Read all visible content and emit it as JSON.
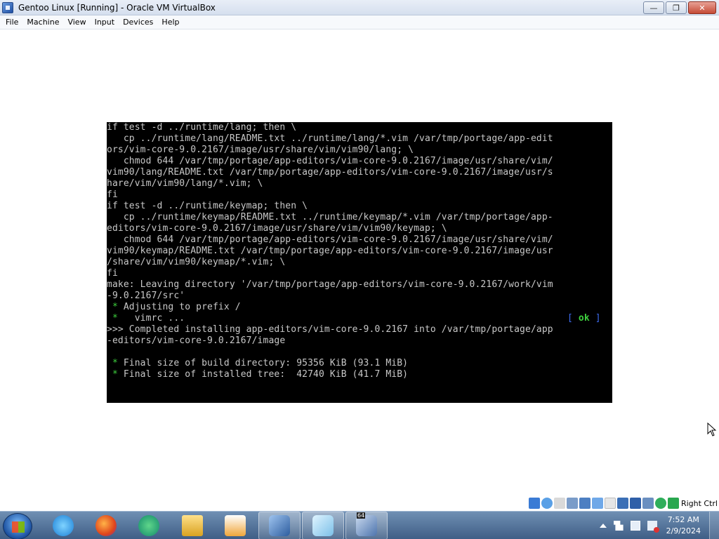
{
  "window": {
    "title": "Gentoo Linux [Running] - Oracle VM VirtualBox",
    "minimize": "—",
    "restore": "❐",
    "close": "✕"
  },
  "menu": {
    "items": [
      "File",
      "Machine",
      "View",
      "Input",
      "Devices",
      "Help"
    ]
  },
  "terminal": {
    "lines": [
      "if test -d ../runtime/lang; then \\",
      "   cp ../runtime/lang/README.txt ../runtime/lang/*.vim /var/tmp/portage/app-edit",
      "ors/vim-core-9.0.2167/image/usr/share/vim/vim90/lang; \\",
      "   chmod 644 /var/tmp/portage/app-editors/vim-core-9.0.2167/image/usr/share/vim/",
      "vim90/lang/README.txt /var/tmp/portage/app-editors/vim-core-9.0.2167/image/usr/s",
      "hare/vim/vim90/lang/*.vim; \\",
      "fi",
      "if test -d ../runtime/keymap; then \\",
      "   cp ../runtime/keymap/README.txt ../runtime/keymap/*.vim /var/tmp/portage/app-",
      "editors/vim-core-9.0.2167/image/usr/share/vim/vim90/keymap; \\",
      "   chmod 644 /var/tmp/portage/app-editors/vim-core-9.0.2167/image/usr/share/vim/",
      "vim90/keymap/README.txt /var/tmp/portage/app-editors/vim-core-9.0.2167/image/usr",
      "/share/vim/vim90/keymap/*.vim; \\",
      "fi",
      "make: Leaving directory '/var/tmp/portage/app-editors/vim-core-9.0.2167/work/vim",
      "-9.0.2167/src'"
    ],
    "adjust_star": " * ",
    "adjust_text": "Adjusting to prefix /",
    "vimrc_star": " * ",
    "vimrc_text": "  vimrc ...",
    "ok_open": "[ ",
    "ok_text": "ok",
    "ok_close": " ]",
    "completed_1": ">>> Completed installing app-editors/vim-core-9.0.2167 into /var/tmp/portage/app",
    "completed_2": "-editors/vim-core-9.0.2167/image",
    "final_star_1": " * ",
    "final_build": "Final size of build directory: 95356 KiB (93.1 MiB)",
    "final_star_2": " * ",
    "final_installed": "Final size of installed tree:  42740 KiB (41.7 MiB)"
  },
  "statusbar": {
    "host_key": "Right Ctrl"
  },
  "taskbar": {
    "time": "7:52 AM",
    "date": "2/9/2024",
    "vbox_badge": "64"
  },
  "colors": {
    "terminal_bg": "#000000",
    "terminal_fg": "#c8c8c8",
    "ok_green": "#3ed13e",
    "bracket_blue": "#3d6cf0"
  }
}
